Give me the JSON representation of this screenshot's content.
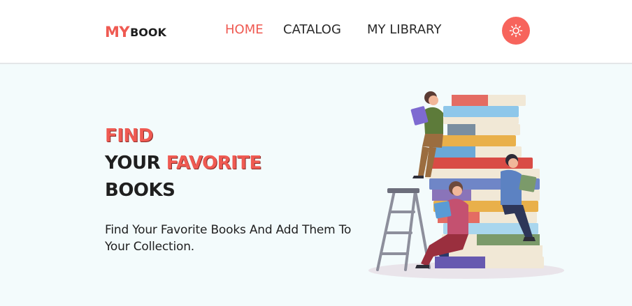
{
  "brand": {
    "logo_my": "MY",
    "logo_book": "BOOK"
  },
  "nav": {
    "home": "HOME",
    "catalog": "CATALOG",
    "library": "MY LIBRARY",
    "active": "HOME"
  },
  "theme_toggle": {
    "icon": "sun-icon"
  },
  "hero": {
    "line1": "FIND",
    "line2_plain": "YOUR ",
    "line2_accent": "FAVORITE",
    "line3": "BOOKS",
    "subtitle": "Find Your Favorite Books And Add Them To Your Collection."
  },
  "colors": {
    "accent": "#ef5a52",
    "header_bg": "#ffffff",
    "page_bg": "#f3fbfc",
    "text": "#1f1f1f"
  },
  "illustration": {
    "icon": "people-reading-on-books-illustration"
  }
}
